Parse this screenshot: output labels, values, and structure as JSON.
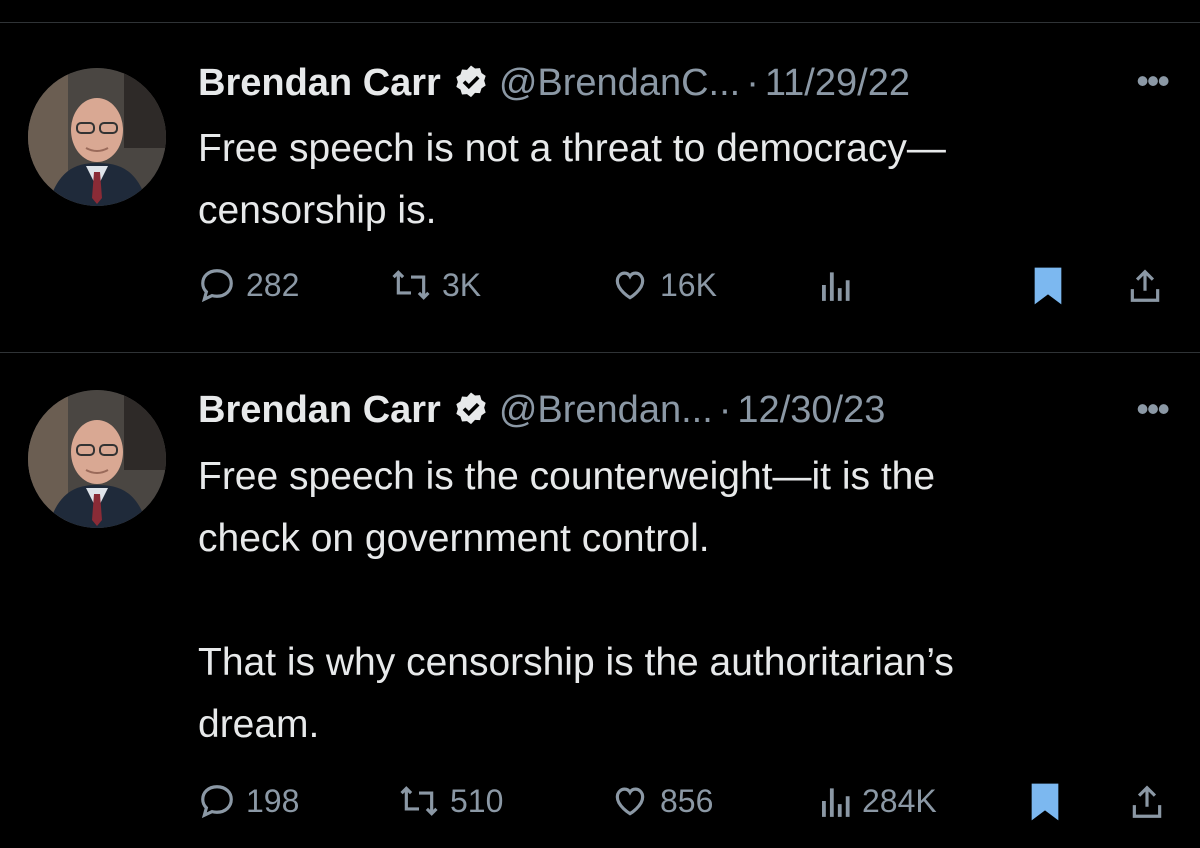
{
  "tweets": [
    {
      "name": "Brendan Carr",
      "handle": "@BrendanC...",
      "sep": "·",
      "date": "11/29/22",
      "more": "•••",
      "text": "Free speech is not a threat to democracy—\ncensorship is.",
      "replies": "282",
      "retweets": "3K",
      "likes": "16K",
      "views": "",
      "bookmarked": true
    },
    {
      "name": "Brendan Carr",
      "handle": "@Brendan...",
      "sep": "·",
      "date": "12/30/23",
      "more": "•••",
      "text": "Free speech is the counterweight—it is the\ncheck on government control.\n\nThat is why censorship is the authoritarian’s\ndream.",
      "replies": "198",
      "retweets": "510",
      "likes": "856",
      "views": "284K",
      "bookmarked": true
    }
  ],
  "colors": {
    "background": "#000000",
    "text": "#e7e9ea",
    "muted": "#8b98a5",
    "bookmark": "#7cb8f0",
    "divider": "#2f3336"
  },
  "icons": [
    "verified-badge-icon",
    "more-icon",
    "reply-icon",
    "retweet-icon",
    "like-icon",
    "views-icon",
    "bookmark-icon",
    "share-icon"
  ]
}
